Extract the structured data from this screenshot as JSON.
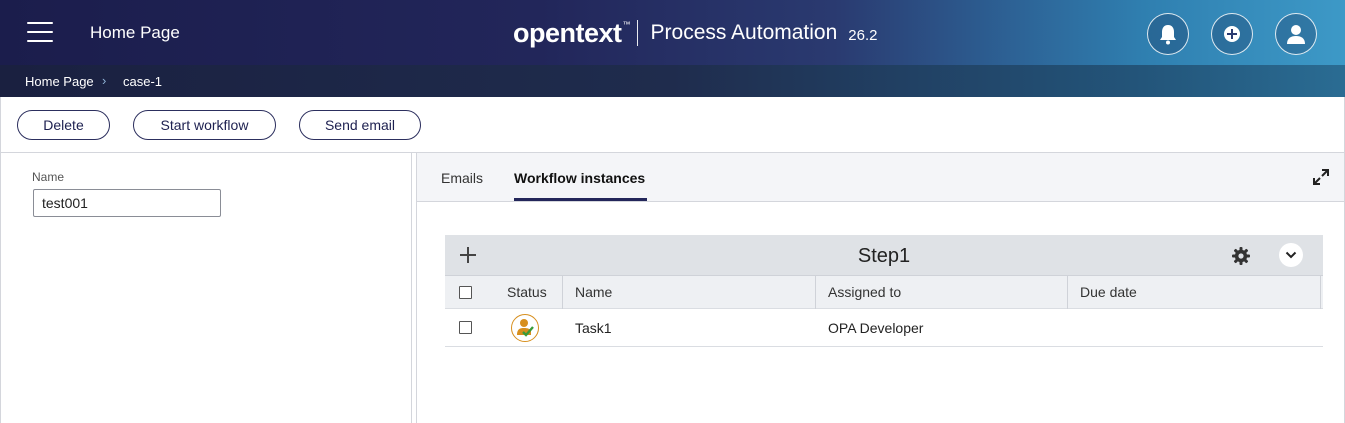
{
  "header": {
    "app_title": "Home Page",
    "brand_logo": "opentext",
    "brand_tm": "™",
    "brand_product": "Process Automation",
    "brand_version": "26.2",
    "icons": [
      "menu-icon",
      "bell-icon",
      "add-circle-icon",
      "user-icon"
    ]
  },
  "breadcrumb": {
    "items": [
      "Home Page",
      "case-1"
    ],
    "separator": "›"
  },
  "toolbar": {
    "delete_label": "Delete",
    "start_workflow_label": "Start workflow",
    "send_email_label": "Send email"
  },
  "form": {
    "name_label": "Name",
    "name_value": "test001"
  },
  "tabs": [
    {
      "label": "Emails",
      "active": false
    },
    {
      "label": "Workflow instances",
      "active": true
    }
  ],
  "grid": {
    "title": "Step1",
    "columns": [
      "Status",
      "Name",
      "Assigned to",
      "Due date"
    ],
    "rows": [
      {
        "status_icon": "user-check-icon",
        "name": "Task1",
        "assigned_to": "OPA Developer",
        "due_date": ""
      }
    ]
  },
  "colors": {
    "header_dark": "#1b1d4c",
    "header_light": "#3d99c7",
    "accent": "#23265a",
    "status_orange": "#d78f1e",
    "status_green": "#3a9b3a"
  }
}
